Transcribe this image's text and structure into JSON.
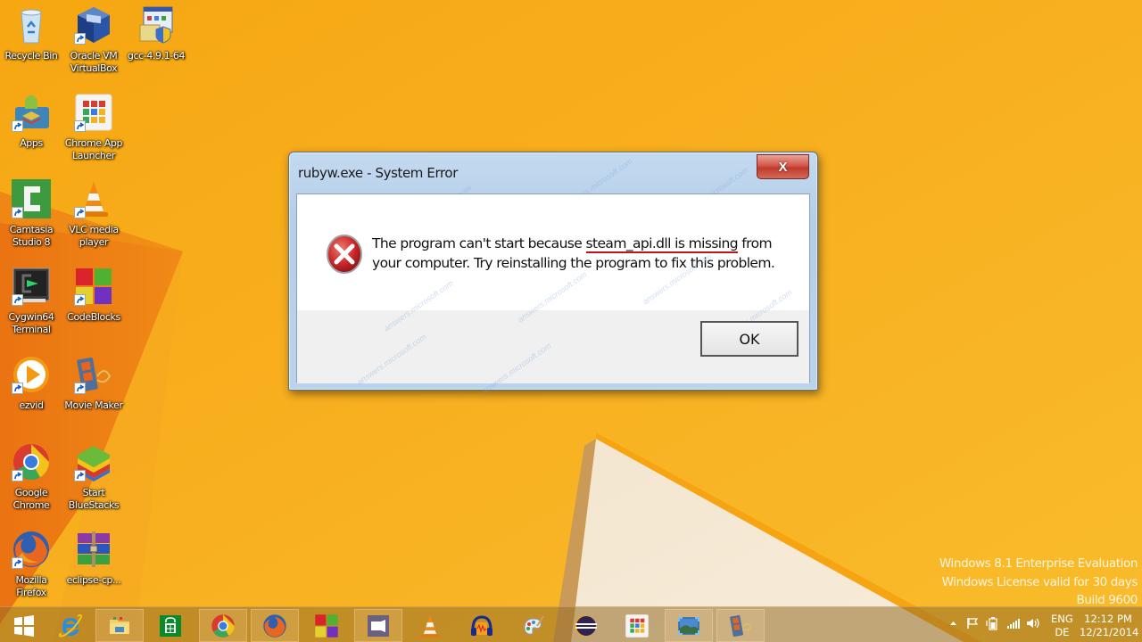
{
  "desktop": {
    "icons": [
      {
        "id": "recycle-bin",
        "label": "Recycle Bin",
        "shortcut": false
      },
      {
        "id": "virtualbox",
        "label": "Oracle VM VirtualBox",
        "shortcut": true
      },
      {
        "id": "gcc",
        "label": "gcc-4.9.1-64",
        "shortcut": false
      },
      {
        "id": "apps",
        "label": "Apps",
        "shortcut": true
      },
      {
        "id": "chrome-app-launcher",
        "label": "Chrome App Launcher",
        "shortcut": true
      },
      {
        "id": "camtasia",
        "label": "Camtasia Studio 8",
        "shortcut": true
      },
      {
        "id": "vlc",
        "label": "VLC media player",
        "shortcut": true
      },
      {
        "id": "cygwin",
        "label": "Cygwin64 Terminal",
        "shortcut": true
      },
      {
        "id": "codeblocks",
        "label": "CodeBlocks",
        "shortcut": true
      },
      {
        "id": "ezvid",
        "label": "ezvid",
        "shortcut": true
      },
      {
        "id": "movie-maker",
        "label": "Movie Maker",
        "shortcut": true
      },
      {
        "id": "google-chrome",
        "label": "Google Chrome",
        "shortcut": true
      },
      {
        "id": "bluestacks",
        "label": "Start BlueStacks",
        "shortcut": true
      },
      {
        "id": "firefox",
        "label": "Mozilla Firefox",
        "shortcut": true
      },
      {
        "id": "eclipse-archive",
        "label": "eclipse-cp...",
        "shortcut": false
      }
    ]
  },
  "dialog": {
    "title": "rubyw.exe - System Error",
    "close_label": "X",
    "message_pre": "The program can't start because ",
    "message_highlight": "steam_api.dll is missing",
    "message_post": " from your computer. Try reinstalling the program to fix this problem.",
    "ok_label": "OK",
    "icon": "error-icon"
  },
  "watermark": {
    "line1": "Windows 8.1 Enterprise Evaluation",
    "line2": "Windows License valid for 30 days",
    "line3": "Build 9600"
  },
  "taskbar": {
    "items": [
      {
        "id": "start",
        "icon": "windows-logo-icon",
        "running": false
      },
      {
        "id": "internet-explorer",
        "icon": "ie-icon",
        "running": false
      },
      {
        "id": "file-explorer",
        "icon": "folder-icon",
        "running": true
      },
      {
        "id": "store",
        "icon": "store-icon",
        "running": false
      },
      {
        "id": "chrome",
        "icon": "chrome-icon",
        "running": true
      },
      {
        "id": "firefox",
        "icon": "firefox-icon",
        "running": true
      },
      {
        "id": "codeblocks",
        "icon": "codeblocks-icon",
        "running": false
      },
      {
        "id": "camtasia-recorder",
        "icon": "camera-icon",
        "running": true
      },
      {
        "id": "vlc",
        "icon": "vlc-icon",
        "running": false
      },
      {
        "id": "audacity",
        "icon": "audacity-icon",
        "running": false
      },
      {
        "id": "paint",
        "icon": "paint-palette-icon",
        "running": false
      },
      {
        "id": "eclipse",
        "icon": "eclipse-icon",
        "running": false
      },
      {
        "id": "chrome-app-launcher",
        "icon": "app-launcher-icon",
        "running": false
      },
      {
        "id": "photo-viewer",
        "icon": "photo-icon",
        "running": true
      },
      {
        "id": "movie-maker",
        "icon": "movie-maker-icon",
        "running": true
      }
    ],
    "tray": {
      "language_top": "ENG",
      "language_bottom": "DE",
      "time": "12:12 PM",
      "date": "12/21/2014"
    }
  }
}
